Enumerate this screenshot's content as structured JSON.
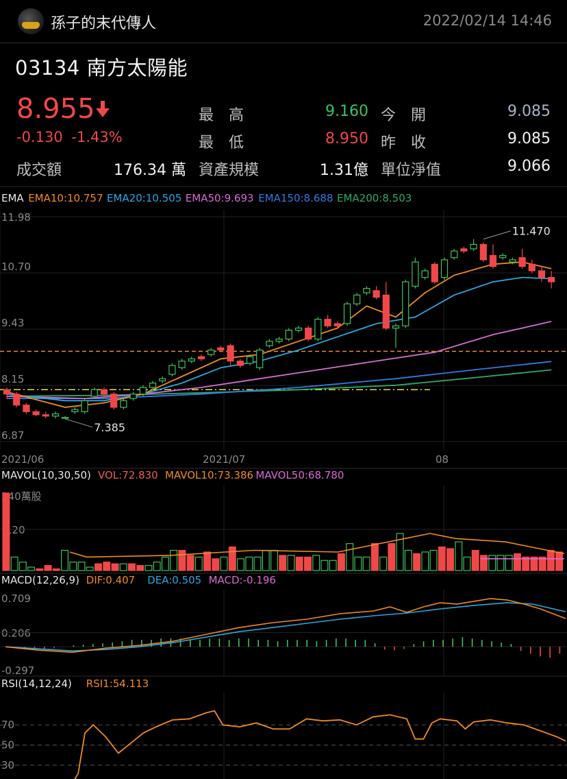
{
  "header": {
    "username": "孫子的末代傳人",
    "datetime": "2022/02/14 14:46"
  },
  "stock": {
    "title": "03134  南方太陽能",
    "price": "8.955",
    "change": "-0.130",
    "change_pct": "-1.43%",
    "stats": [
      {
        "label": "最　高",
        "value": "9.160",
        "color": "#3cc35d"
      },
      {
        "label": "今　開",
        "value": "9.085",
        "color": "#a9b3c6"
      },
      {
        "label": "最　低",
        "value": "8.950",
        "color": "#f04848"
      },
      {
        "label": "昨　收",
        "value": "9.085",
        "color": "#f2f2f2"
      },
      {
        "label": "成交額",
        "value": "176.34 萬",
        "color": "#f2f2f2"
      },
      {
        "label": "資產規模",
        "value": "1.31億",
        "color": "#f2f2f2"
      },
      {
        "label": "單位淨值",
        "value": "9.066",
        "color": "#f2f2f2"
      }
    ]
  },
  "chart_data": [
    {
      "type": "candlestick",
      "legend": [
        {
          "text": "EMA",
          "color": "#e8e8e8"
        },
        {
          "text": "EMA10:10.757",
          "color": "#f08a24"
        },
        {
          "text": "EMA20:10.505",
          "color": "#2aa7e0"
        },
        {
          "text": "EMA50:9.693",
          "color": "#d86bd6"
        },
        {
          "text": "EMA150:8.688",
          "color": "#2f7be3"
        },
        {
          "text": "EMA200:8.503",
          "color": "#2eaa6a"
        }
      ],
      "y_ticks": [
        "11.98",
        "10.70",
        "9.43",
        "8.15",
        "6.87"
      ],
      "ylim": [
        6.87,
        11.98
      ],
      "x_ticks": [
        {
          "label": "2021/06",
          "i": 0
        },
        {
          "label": "2021/07",
          "i": 21
        },
        {
          "label": "08",
          "i": 44
        }
      ],
      "annotations": [
        {
          "text": "11.470",
          "i": 49,
          "value": 11.47
        },
        {
          "text": "7.385",
          "i": 6,
          "value": 7.385
        }
      ],
      "hlines": [
        {
          "value": 8.92,
          "color": "#f08a24"
        },
        {
          "value": 8.05,
          "color": "#e5e52e"
        }
      ],
      "candles": [
        [
          8.05,
          7.95,
          8.1,
          7.85
        ],
        [
          7.95,
          7.7,
          8.0,
          7.65
        ],
        [
          7.7,
          7.55,
          7.75,
          7.5
        ],
        [
          7.55,
          7.48,
          7.6,
          7.45
        ],
        [
          7.48,
          7.45,
          7.55,
          7.4
        ],
        [
          7.45,
          7.5,
          7.55,
          7.4
        ],
        [
          7.4,
          7.42,
          7.45,
          7.38
        ],
        [
          7.55,
          7.6,
          7.65,
          7.5
        ],
        [
          7.55,
          7.8,
          7.85,
          7.5
        ],
        [
          7.9,
          8.05,
          8.1,
          7.85
        ],
        [
          8.05,
          7.95,
          8.1,
          7.9
        ],
        [
          7.95,
          7.65,
          8.0,
          7.6
        ],
        [
          7.65,
          7.8,
          7.85,
          7.6
        ],
        [
          7.85,
          7.95,
          8.0,
          7.8
        ],
        [
          7.95,
          8.1,
          8.15,
          7.9
        ],
        [
          8.1,
          8.2,
          8.25,
          8.05
        ],
        [
          8.25,
          8.3,
          8.35,
          8.2
        ],
        [
          8.4,
          8.6,
          8.65,
          8.35
        ],
        [
          8.55,
          8.7,
          8.75,
          8.5
        ],
        [
          8.7,
          8.75,
          8.8,
          8.65
        ],
        [
          8.8,
          8.75,
          8.85,
          8.7
        ],
        [
          8.85,
          8.95,
          9.0,
          8.8
        ],
        [
          9.0,
          8.95,
          9.05,
          8.9
        ],
        [
          9.05,
          8.7,
          9.1,
          8.6
        ],
        [
          8.7,
          8.6,
          8.75,
          8.55
        ],
        [
          8.65,
          8.8,
          8.85,
          8.6
        ],
        [
          8.55,
          8.95,
          9.0,
          8.5
        ],
        [
          9.05,
          9.15,
          9.2,
          9.0
        ],
        [
          9.15,
          9.2,
          9.25,
          9.1
        ],
        [
          9.2,
          9.4,
          9.45,
          9.15
        ],
        [
          9.4,
          9.45,
          9.5,
          9.35
        ],
        [
          9.45,
          9.2,
          9.5,
          9.15
        ],
        [
          9.2,
          9.65,
          9.7,
          9.15
        ],
        [
          9.65,
          9.5,
          9.75,
          9.45
        ],
        [
          9.55,
          9.5,
          9.6,
          9.45
        ],
        [
          9.55,
          10.0,
          10.05,
          9.5
        ],
        [
          10.0,
          10.2,
          10.25,
          9.95
        ],
        [
          10.25,
          10.35,
          10.4,
          10.2
        ],
        [
          10.3,
          10.15,
          10.4,
          10.1
        ],
        [
          10.2,
          9.45,
          10.5,
          9.4
        ],
        [
          9.45,
          9.5,
          9.55,
          9.0
        ],
        [
          9.5,
          10.5,
          10.55,
          9.45
        ],
        [
          10.4,
          10.95,
          11.05,
          10.35
        ],
        [
          10.6,
          10.75,
          10.8,
          10.55
        ],
        [
          10.9,
          10.5,
          10.95,
          10.45
        ],
        [
          10.6,
          11.0,
          11.05,
          10.55
        ],
        [
          11.05,
          11.2,
          11.25,
          11.0
        ],
        [
          11.25,
          11.2,
          11.3,
          11.15
        ],
        [
          11.25,
          11.35,
          11.47,
          11.2
        ],
        [
          11.35,
          11.0,
          11.4,
          10.95
        ],
        [
          11.1,
          10.85,
          11.35,
          10.8
        ],
        [
          11.05,
          11.1,
          11.15,
          11.0
        ],
        [
          10.95,
          11.0,
          11.05,
          10.9
        ],
        [
          11.05,
          10.85,
          11.25,
          10.8
        ],
        [
          10.9,
          10.75,
          11.0,
          10.7
        ],
        [
          10.75,
          10.6,
          10.85,
          10.5
        ],
        [
          10.6,
          10.5,
          10.75,
          10.35
        ]
      ],
      "ema": [
        {
          "name": "EMA10",
          "color": "#f08a24",
          "points": [
            [
              0,
              8.0
            ],
            [
              6,
              7.65
            ],
            [
              10,
              7.75
            ],
            [
              14,
              7.95
            ],
            [
              18,
              8.35
            ],
            [
              22,
              8.75
            ],
            [
              26,
              8.85
            ],
            [
              30,
              9.15
            ],
            [
              34,
              9.45
            ],
            [
              37,
              9.95
            ],
            [
              40,
              9.7
            ],
            [
              43,
              10.25
            ],
            [
              46,
              10.65
            ],
            [
              50,
              10.9
            ],
            [
              53,
              10.95
            ],
            [
              56,
              10.8
            ]
          ]
        },
        {
          "name": "EMA20",
          "color": "#2aa7e0",
          "points": [
            [
              0,
              7.95
            ],
            [
              6,
              7.8
            ],
            [
              10,
              7.8
            ],
            [
              14,
              7.95
            ],
            [
              18,
              8.2
            ],
            [
              22,
              8.55
            ],
            [
              26,
              8.7
            ],
            [
              30,
              8.95
            ],
            [
              34,
              9.25
            ],
            [
              38,
              9.55
            ],
            [
              42,
              9.7
            ],
            [
              46,
              10.2
            ],
            [
              50,
              10.5
            ],
            [
              53,
              10.6
            ],
            [
              56,
              10.57
            ]
          ]
        },
        {
          "name": "EMA50",
          "color": "#d86bd6",
          "points": [
            [
              0,
              7.9
            ],
            [
              8,
              7.85
            ],
            [
              14,
              7.95
            ],
            [
              20,
              8.1
            ],
            [
              26,
              8.3
            ],
            [
              32,
              8.5
            ],
            [
              38,
              8.7
            ],
            [
              44,
              8.9
            ],
            [
              50,
              9.3
            ],
            [
              56,
              9.6
            ]
          ]
        },
        {
          "name": "EMA150",
          "color": "#2f7be3",
          "points": [
            [
              0,
              7.85
            ],
            [
              10,
              7.85
            ],
            [
              20,
              7.95
            ],
            [
              30,
              8.1
            ],
            [
              40,
              8.3
            ],
            [
              48,
              8.5
            ],
            [
              56,
              8.69
            ]
          ]
        },
        {
          "name": "EMA200",
          "color": "#2eaa6a",
          "points": [
            [
              0,
              7.9
            ],
            [
              10,
              7.92
            ],
            [
              20,
              7.98
            ],
            [
              30,
              8.05
            ],
            [
              40,
              8.15
            ],
            [
              48,
              8.32
            ],
            [
              56,
              8.5
            ]
          ]
        }
      ]
    },
    {
      "type": "bar",
      "legend": [
        {
          "text": "MAVOL(10,30,50)",
          "color": "#e8e8e8"
        },
        {
          "text": "VOL:72.830",
          "color": "#f05a5a"
        },
        {
          "text": "MAVOL10:73.386",
          "color": "#f08a24"
        },
        {
          "text": "MAVOL50:68.780",
          "color": "#d86bd6"
        }
      ],
      "y_ticks": [
        "240萬股",
        "120"
      ],
      "ylim": [
        0,
        240
      ],
      "volumes": [
        230,
        40,
        25,
        10,
        5,
        15,
        5,
        60,
        25,
        25,
        10,
        20,
        25,
        20,
        20,
        20,
        15,
        15,
        25,
        40,
        60,
        60,
        45,
        40,
        55,
        35,
        40,
        70,
        35,
        40,
        40,
        60,
        60,
        45,
        45,
        40,
        40,
        45,
        30,
        30,
        50,
        80,
        40,
        40,
        80,
        40,
        80,
        110,
        60,
        50,
        55,
        60,
        70,
        65,
        85,
        40,
        60,
        45,
        45,
        45,
        45,
        50,
        40,
        40,
        40,
        60,
        55
      ],
      "vol_colors": "rgggrrrggggrrrgrrggggrrgrrgrgggggrgrrgggrgggrgrggrggrrggrrgggrrrrrr",
      "mavol10": [
        [
          8,
          55
        ],
        [
          10,
          40
        ],
        [
          20,
          45
        ],
        [
          30,
          60
        ],
        [
          40,
          55
        ],
        [
          44,
          75
        ],
        [
          48,
          95
        ],
        [
          51,
          110
        ],
        [
          54,
          95
        ],
        [
          60,
          85
        ],
        [
          66,
          55
        ],
        [
          67,
          50
        ]
      ],
      "mavol50": [
        [
          57,
          35
        ],
        [
          67,
          35
        ]
      ]
    },
    {
      "type": "line",
      "legend": [
        {
          "text": "MACD(12,26,9)",
          "color": "#e8e8e8"
        },
        {
          "text": "DIF:0.407",
          "color": "#f08a24"
        },
        {
          "text": "DEA:0.505",
          "color": "#2aa7e0"
        },
        {
          "text": "MACD:-0.196",
          "color": "#d86bd6"
        }
      ],
      "y_ticks": [
        "0.709",
        "0.206",
        "-0.297"
      ],
      "ylim": [
        -0.297,
        0.709
      ],
      "dif": [
        [
          0,
          0.0
        ],
        [
          4,
          -0.05
        ],
        [
          8,
          -0.08
        ],
        [
          12,
          -0.02
        ],
        [
          16,
          0.02
        ],
        [
          20,
          0.08
        ],
        [
          24,
          0.18
        ],
        [
          28,
          0.28
        ],
        [
          32,
          0.35
        ],
        [
          36,
          0.4
        ],
        [
          40,
          0.48
        ],
        [
          44,
          0.52
        ],
        [
          46,
          0.58
        ],
        [
          48,
          0.5
        ],
        [
          50,
          0.58
        ],
        [
          52,
          0.64
        ],
        [
          54,
          0.62
        ],
        [
          56,
          0.66
        ],
        [
          58,
          0.7
        ],
        [
          60,
          0.68
        ],
        [
          62,
          0.62
        ],
        [
          64,
          0.55
        ],
        [
          67,
          0.41
        ]
      ],
      "dea": [
        [
          0,
          0.0
        ],
        [
          4,
          -0.03
        ],
        [
          8,
          -0.06
        ],
        [
          12,
          -0.04
        ],
        [
          16,
          0.0
        ],
        [
          20,
          0.06
        ],
        [
          24,
          0.14
        ],
        [
          28,
          0.22
        ],
        [
          32,
          0.28
        ],
        [
          36,
          0.34
        ],
        [
          40,
          0.4
        ],
        [
          44,
          0.45
        ],
        [
          48,
          0.49
        ],
        [
          52,
          0.55
        ],
        [
          56,
          0.6
        ],
        [
          60,
          0.64
        ],
        [
          63,
          0.62
        ],
        [
          67,
          0.51
        ]
      ],
      "macd": [
        0,
        -0.02,
        -0.03,
        -0.04,
        -0.03,
        -0.02,
        0,
        0.02,
        0.03,
        0.04,
        0.05,
        0.06,
        0.08,
        0.1,
        0.1,
        0.1,
        0.12,
        0.12,
        0.12,
        0.1,
        0.1,
        0.12,
        0.12,
        0.1,
        0.12,
        0.12,
        0.1,
        0.1,
        0.08,
        0.1,
        0.1,
        0.1,
        0.08,
        0.1,
        0.12,
        0.12,
        0.1,
        0.1,
        0.05,
        -0.04,
        -0.05,
        -0.03,
        0.04,
        0.08,
        0.1,
        0.1,
        0.12,
        0.14,
        0.12,
        0.1,
        0.08,
        0.06,
        0.04,
        -0.06,
        -0.1,
        -0.14,
        -0.16,
        -0.1
      ]
    },
    {
      "type": "line",
      "legend": [
        {
          "text": "RSI(14,12,24)",
          "color": "#e8e8e8"
        },
        {
          "text": "RSI1:54.113",
          "color": "#f08a24"
        }
      ],
      "y_ticks": [
        "70",
        "50",
        "30"
      ],
      "ylim": [
        0,
        100
      ],
      "rsi": [
        [
          0,
          12
        ],
        [
          5,
          12
        ],
        [
          8,
          12
        ],
        [
          8.7,
          22
        ],
        [
          9.5,
          62
        ],
        [
          10.5,
          70
        ],
        [
          12,
          58
        ],
        [
          13.5,
          42
        ],
        [
          15,
          52
        ],
        [
          16.5,
          62
        ],
        [
          18,
          68
        ],
        [
          20,
          75
        ],
        [
          22,
          76
        ],
        [
          24,
          82
        ],
        [
          25,
          84
        ],
        [
          26,
          70
        ],
        [
          28,
          68
        ],
        [
          30,
          72
        ],
        [
          32,
          66
        ],
        [
          34,
          66
        ],
        [
          36,
          76
        ],
        [
          38,
          74
        ],
        [
          40,
          75
        ],
        [
          42,
          70
        ],
        [
          44,
          78
        ],
        [
          46,
          80
        ],
        [
          48,
          76
        ],
        [
          49,
          56
        ],
        [
          50,
          56
        ],
        [
          51,
          72
        ],
        [
          52,
          76
        ],
        [
          54,
          74
        ],
        [
          55,
          66
        ],
        [
          56,
          73
        ],
        [
          58,
          75
        ],
        [
          60,
          72
        ],
        [
          62,
          70
        ],
        [
          64,
          64
        ],
        [
          66,
          58
        ],
        [
          67,
          54
        ]
      ]
    }
  ]
}
